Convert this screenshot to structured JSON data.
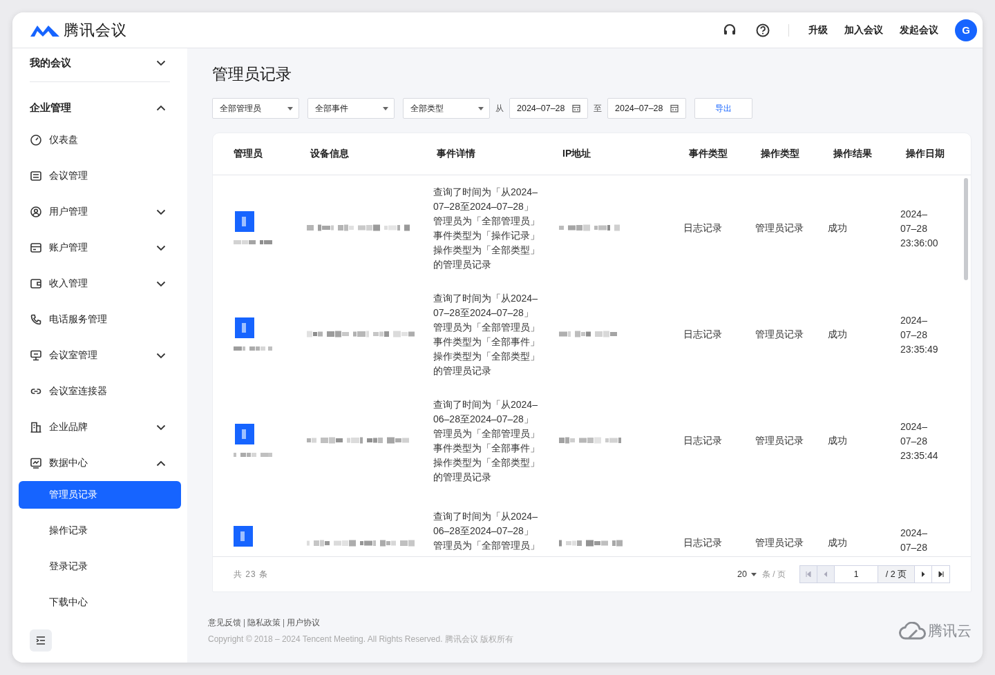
{
  "header": {
    "logo_text": "腾讯会议",
    "links": [
      "升级",
      "加入会议",
      "发起会议"
    ],
    "avatar": "G"
  },
  "sidebar": {
    "sections": [
      {
        "label": "我的会议",
        "expanded": false
      },
      {
        "label": "企业管理",
        "expanded": true
      }
    ],
    "items": [
      {
        "label": "仪表盘"
      },
      {
        "label": "会议管理"
      },
      {
        "label": "用户管理",
        "expanded": false
      },
      {
        "label": "账户管理",
        "expanded": false
      },
      {
        "label": "收入管理",
        "expanded": false
      },
      {
        "label": "电话服务管理"
      },
      {
        "label": "会议室管理",
        "expanded": false
      },
      {
        "label": "会议室连接器"
      },
      {
        "label": "企业品牌",
        "expanded": false
      },
      {
        "label": "数据中心",
        "expanded": true,
        "children": [
          {
            "label": "管理员记录",
            "selected": true
          },
          {
            "label": "操作记录",
            "selected": false
          },
          {
            "label": "登录记录",
            "selected": false
          },
          {
            "label": "下载中心",
            "selected": false
          }
        ]
      }
    ]
  },
  "page": {
    "title": "管理员记录",
    "filters": {
      "selects": [
        "全部管理员",
        "全部事件",
        "全部类型"
      ],
      "from_label": "从",
      "from": "2024–07–28",
      "to_label": "至",
      "to": "2024–07–28",
      "export": "导出"
    },
    "table": {
      "columns": [
        "管理员",
        "设备信息",
        "事件详情",
        "IP地址",
        "事件类型",
        "操作类型",
        "操作结果",
        "操作日期"
      ],
      "rows": [
        {
          "detail": [
            "查询了时间为「从2024–",
            "07–28至2024–07–28」",
            "管理员为「全部管理员」",
            "事件类型为「操作记录」",
            "操作类型为「全部类型」",
            "的管理员记录"
          ],
          "event_type": "日志记录",
          "op_type": "管理员记录",
          "result": "成功",
          "date": [
            "2024–",
            "07–28",
            "23:36:00"
          ]
        },
        {
          "detail": [
            "查询了时间为「从2024–",
            "07–28至2024–07–28」",
            "管理员为「全部管理员」",
            "事件类型为「全部事件」",
            "操作类型为「全部类型」",
            "的管理员记录"
          ],
          "event_type": "日志记录",
          "op_type": "管理员记录",
          "result": "成功",
          "date": [
            "2024–",
            "07–28",
            "23:35:49"
          ]
        },
        {
          "detail": [
            "查询了时间为「从2024–",
            "06–28至2024–07–28」",
            "管理员为「全部管理员」",
            "事件类型为「全部事件」",
            "操作类型为「全部类型」",
            "的管理员记录"
          ],
          "event_type": "日志记录",
          "op_type": "管理员记录",
          "result": "成功",
          "date": [
            "2024–",
            "07–28",
            "23:35:44"
          ]
        },
        {
          "detail": [
            "查询了时间为「从2024–",
            "06–28至2024–07–28」",
            "管理员为「全部管理员」"
          ],
          "event_type": "日志记录",
          "op_type": "管理员记录",
          "result": "成功",
          "date": [
            "2024–",
            "07–28"
          ]
        }
      ]
    },
    "pagination": {
      "total": "共 23 条",
      "page_size": "20",
      "per_page": "条 / 页",
      "page": "1",
      "pages": "/ 2 页"
    }
  },
  "footer": {
    "links": [
      "意见反馈",
      "隐私政策",
      "用户协议"
    ],
    "copyright": "Copyright © 2018 – 2024 Tencent Meeting. All Rights Reserved. 腾讯会议 版权所有",
    "brand": "腾讯云"
  }
}
